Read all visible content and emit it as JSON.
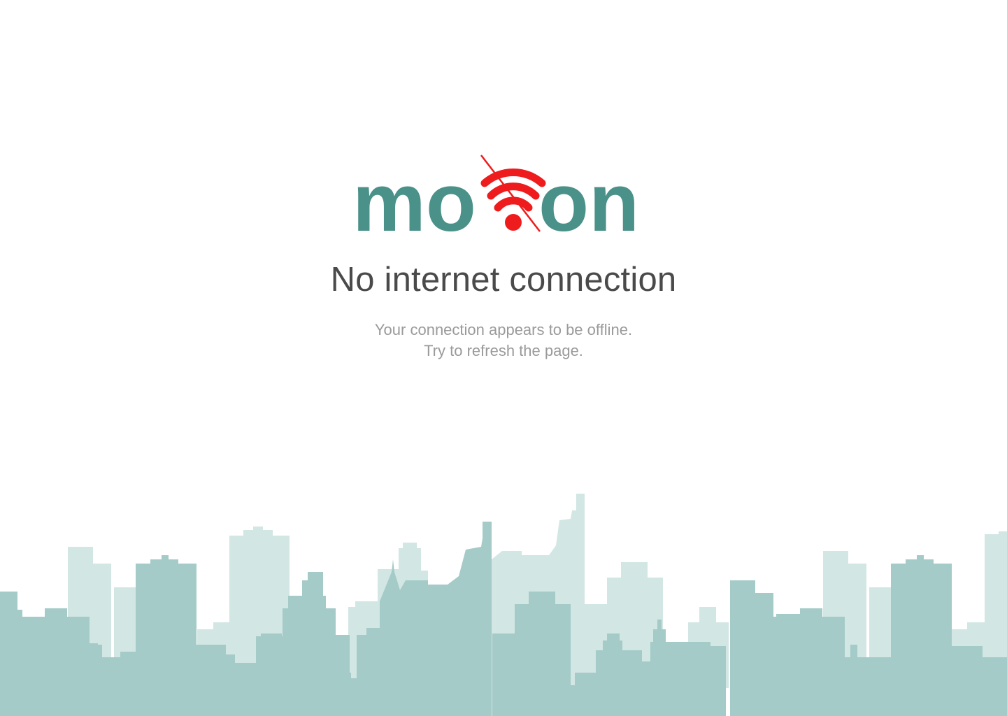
{
  "brand": {
    "logo_left": "mo",
    "logo_right": "on",
    "logo_color": "#4a9189",
    "wifi_color": "#ee1c1c",
    "wifi_icon": "wifi-off-icon"
  },
  "message": {
    "title": "No internet connection",
    "line1": "Your connection appears to be offline.",
    "line2": "Try to refresh the page."
  },
  "colors": {
    "background": "#ffffff",
    "title": "#4a4a4a",
    "subtitle": "#9a9a9a",
    "skyline_back": "#d2e6e4",
    "skyline_front": "#a4cbc8"
  }
}
